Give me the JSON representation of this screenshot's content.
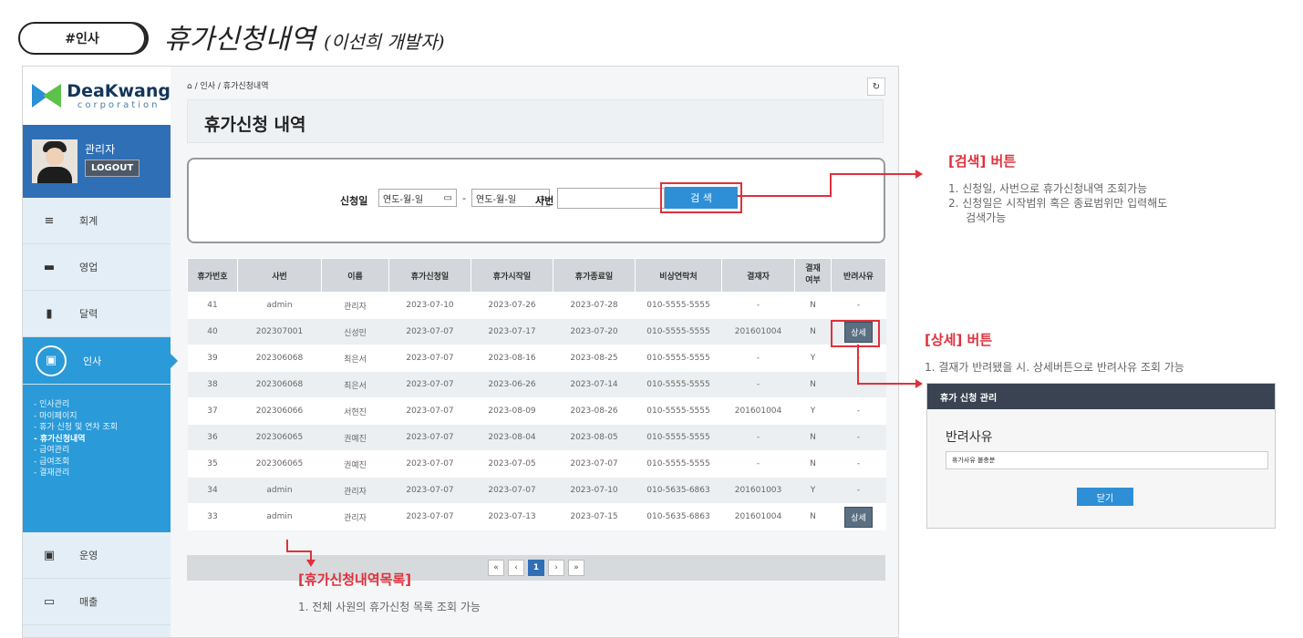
{
  "tag_label": "#인사",
  "heading": {
    "main": "휴가신청내역",
    "sub": "(이선희 개발자)"
  },
  "logo": {
    "name": "DeaKwang",
    "sub": "corporation"
  },
  "profile": {
    "name": "관리자",
    "logout": "LOGOUT"
  },
  "menu": [
    {
      "label": "회계",
      "icon": "list-icon",
      "glyph": "≡"
    },
    {
      "label": "영업",
      "icon": "truck-icon",
      "glyph": "▬"
    },
    {
      "label": "달력",
      "icon": "clipboard-icon",
      "glyph": "▮"
    },
    {
      "label": "인사",
      "icon": "calculator-icon",
      "glyph": "▣"
    }
  ],
  "submenu": [
    "- 인사관리",
    "- 마이페이지",
    "- 휴가 신청 및 연차 조회",
    "- 휴가신청내역",
    "- 급여관리",
    "- 급여조회",
    "- 결재관리"
  ],
  "menu_bottom": [
    {
      "label": "운영",
      "icon": "calculator-icon",
      "glyph": "▣"
    },
    {
      "label": "매출",
      "icon": "monitor-icon",
      "glyph": "▭"
    }
  ],
  "breadcrumb": "/ 인사 / 휴가신청내역",
  "refresh_glyph": "↻",
  "page_title": "휴가신청 내역",
  "search": {
    "date_label": "신청일",
    "date_from": "연도-월-일",
    "date_to": "연도-월-일",
    "dash": "-",
    "emp_label": "사번",
    "button": "검 색"
  },
  "table": {
    "headers": [
      "휴가번호",
      "사번",
      "이름",
      "휴가신청일",
      "휴가시작일",
      "휴가종료일",
      "비상연락처",
      "결재자",
      "결재\n여부",
      "반려사유"
    ],
    "rows": [
      [
        "41",
        "admin",
        "관리자",
        "2023-07-10",
        "2023-07-26",
        "2023-07-28",
        "010-5555-5555",
        "-",
        "N",
        "-"
      ],
      [
        "40",
        "202307001",
        "신성민",
        "2023-07-07",
        "2023-07-17",
        "2023-07-20",
        "010-5555-5555",
        "201601004",
        "N",
        "상세"
      ],
      [
        "39",
        "202306068",
        "최은서",
        "2023-07-07",
        "2023-08-16",
        "2023-08-25",
        "010-5555-5555",
        "-",
        "Y",
        "-"
      ],
      [
        "38",
        "202306068",
        "최은서",
        "2023-07-07",
        "2023-06-26",
        "2023-07-14",
        "010-5555-5555",
        "-",
        "N",
        "-"
      ],
      [
        "37",
        "202306066",
        "서현진",
        "2023-07-07",
        "2023-08-09",
        "2023-08-26",
        "010-5555-5555",
        "201601004",
        "Y",
        "-"
      ],
      [
        "36",
        "202306065",
        "권예진",
        "2023-07-07",
        "2023-08-04",
        "2023-08-05",
        "010-5555-5555",
        "-",
        "N",
        "-"
      ],
      [
        "35",
        "202306065",
        "권예진",
        "2023-07-07",
        "2023-07-05",
        "2023-07-07",
        "010-5555-5555",
        "-",
        "N",
        "-"
      ],
      [
        "34",
        "admin",
        "관리자",
        "2023-07-07",
        "2023-07-07",
        "2023-07-10",
        "010-5635-6863",
        "201601003",
        "Y",
        "-"
      ],
      [
        "33",
        "admin",
        "관리자",
        "2023-07-07",
        "2023-07-13",
        "2023-07-15",
        "010-5635-6863",
        "201601004",
        "N",
        "상세"
      ]
    ]
  },
  "pager": [
    "«",
    "‹",
    "1",
    "›",
    "»"
  ],
  "annotations": {
    "search": {
      "title": "[검색] 버튼",
      "lines": [
        "1.  신청일, 사번으로 휴가신청내역 조회가능",
        "2.  신청일은 시작범위 혹은 종료범위만 입력해도",
        "     검색가능"
      ]
    },
    "detail": {
      "title": "[상세] 버튼",
      "lines": [
        "1. 결재가 반려됐을 시. 상세버튼으로 반려사유 조회 가능"
      ]
    },
    "list": {
      "title": "[휴가신청내역목록]",
      "lines": [
        "1. 전체 사원의 휴가신청 목록 조회 가능"
      ]
    }
  },
  "modal": {
    "header": "휴가 신청 관리",
    "label": "반려사유",
    "value": "휴가사유 불충분",
    "button": "닫기"
  },
  "colors": {
    "accent": "#2a9ad8",
    "highlight": "#e0303c",
    "profile_bg": "#2e6fb6"
  }
}
